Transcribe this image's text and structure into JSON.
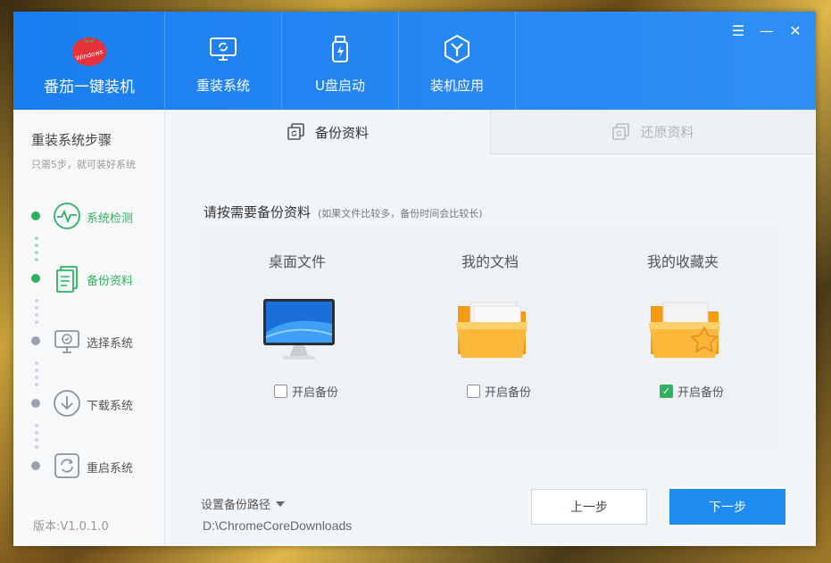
{
  "brand": {
    "name": "番茄一键装机",
    "logo_text": "Windows"
  },
  "nav": [
    {
      "label": "重装系统",
      "icon": "monitor-refresh-icon"
    },
    {
      "label": "U盘启动",
      "icon": "usb-icon"
    },
    {
      "label": "装机应用",
      "icon": "app-hex-icon"
    }
  ],
  "window_controls": {
    "menu": "☰",
    "minimize": "—",
    "close": "✕"
  },
  "sidebar": {
    "title": "重装系统步骤",
    "subtitle": "只需5步，就可装好系统",
    "steps": [
      {
        "label": "系统检测",
        "state": "done"
      },
      {
        "label": "备份资料",
        "state": "done"
      },
      {
        "label": "选择系统",
        "state": "pending"
      },
      {
        "label": "下载系统",
        "state": "pending"
      },
      {
        "label": "重启系统",
        "state": "pending"
      }
    ],
    "version": "版本:V1.0.1.0"
  },
  "tabs": [
    {
      "label": "备份资料",
      "active": true
    },
    {
      "label": "还原资料",
      "active": false
    }
  ],
  "prompt": {
    "text": "请按需要备份资料",
    "hint": "(如果文件比较多，备份时间会比较长)"
  },
  "cards": [
    {
      "title": "桌面文件",
      "checkbox_label": "开启备份",
      "checked": false
    },
    {
      "title": "我的文档",
      "checkbox_label": "开启备份",
      "checked": false
    },
    {
      "title": "我的收藏夹",
      "checkbox_label": "开启备份",
      "checked": true
    }
  ],
  "backup_path": {
    "label": "设置备份路径",
    "value": "D:\\ChromeCoreDownloads"
  },
  "buttons": {
    "prev": "上一步",
    "next": "下一步"
  },
  "colors": {
    "header": "#1a7ef0",
    "accent_green": "#2fb25f",
    "primary_button": "#1e8bef"
  }
}
